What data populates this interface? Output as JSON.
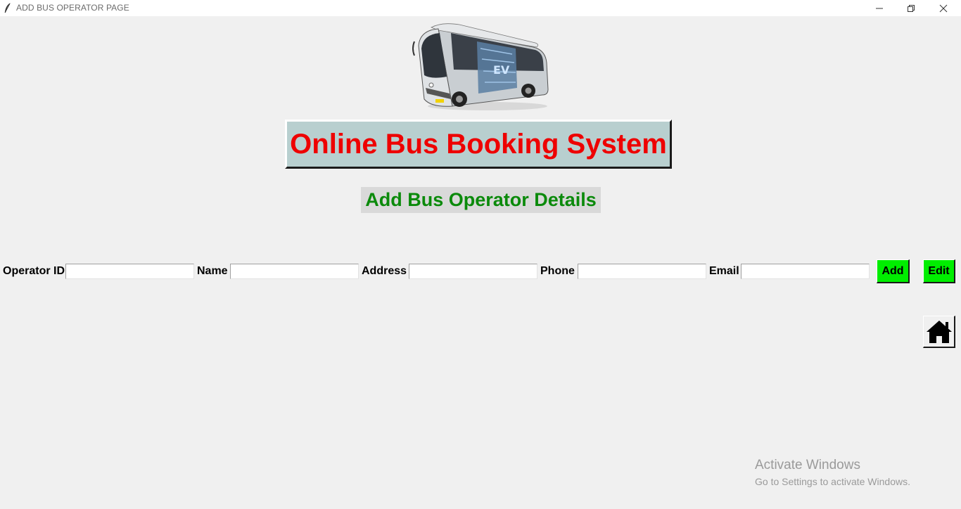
{
  "window": {
    "title": "ADD BUS OPERATOR PAGE",
    "app_icon": "feather-icon",
    "controls": [
      "minimize-icon",
      "restore-icon",
      "close-icon"
    ]
  },
  "header": {
    "image": "bus-image",
    "banner": "Online Bus Booking System",
    "subheading": "Add Bus Operator Details"
  },
  "form": {
    "operator_id": {
      "label": "Operator ID",
      "value": ""
    },
    "name": {
      "label": "Name",
      "value": ""
    },
    "address": {
      "label": "Address",
      "value": ""
    },
    "phone": {
      "label": "Phone",
      "value": ""
    },
    "email": {
      "label": "Email",
      "value": ""
    }
  },
  "buttons": {
    "add": "Add",
    "edit": "Edit",
    "home_icon": "home-icon"
  },
  "watermark": {
    "title": "Activate Windows",
    "subtitle": "Go to Settings to activate Windows."
  },
  "colors": {
    "background": "#f0f0f0",
    "banner_bg": "#b8cfcf",
    "banner_text": "#ee0000",
    "subheading_text": "#0b8a0b",
    "button_green": "#00ee00"
  }
}
